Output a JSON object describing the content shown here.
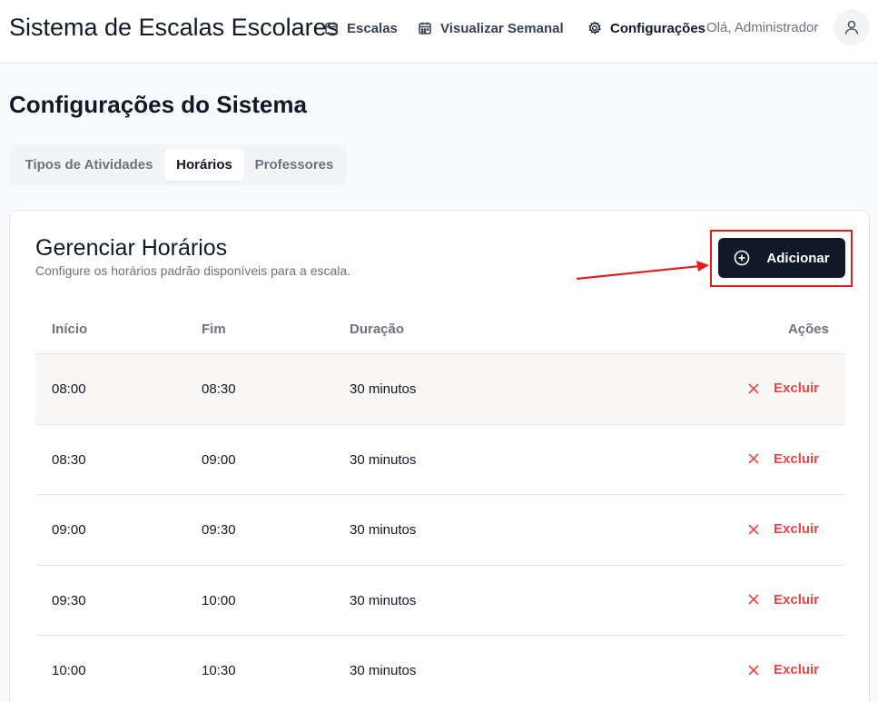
{
  "header": {
    "app_title": "Sistema de Escalas Escolares",
    "nav": [
      {
        "label": "Escalas",
        "icon": "calendar-icon"
      },
      {
        "label": "Visualizar Semanal",
        "icon": "calendar-week-icon"
      },
      {
        "label": "Configurações",
        "icon": "gear-icon"
      }
    ],
    "greeting": "Olá, Administrador",
    "avatar_icon": "user-icon"
  },
  "page": {
    "title": "Configurações do Sistema",
    "tabs": [
      {
        "label": "Tipos de Atividades"
      },
      {
        "label": "Horários"
      },
      {
        "label": "Professores"
      }
    ],
    "active_tab": "Horários"
  },
  "card": {
    "title": "Gerenciar Horários",
    "subtitle": "Configure os horários padrão disponíveis para a escala.",
    "add_button": "Adicionar",
    "add_icon": "plus-circle-icon"
  },
  "table": {
    "headers": {
      "start": "Início",
      "end": "Fim",
      "duration": "Duração",
      "actions": "Ações"
    },
    "rows": [
      {
        "start": "08:00",
        "end": "08:30",
        "duration": "30 minutos",
        "action": "Excluir"
      },
      {
        "start": "08:30",
        "end": "09:00",
        "duration": "30 minutos",
        "action": "Excluir"
      },
      {
        "start": "09:00",
        "end": "09:30",
        "duration": "30 minutos",
        "action": "Excluir"
      },
      {
        "start": "09:30",
        "end": "10:00",
        "duration": "30 minutos",
        "action": "Excluir"
      },
      {
        "start": "10:00",
        "end": "10:30",
        "duration": "30 minutos",
        "action": "Excluir"
      }
    ]
  },
  "colors": {
    "primary": "#111827",
    "danger": "#ef4444",
    "annotation": "#e11d1d"
  }
}
